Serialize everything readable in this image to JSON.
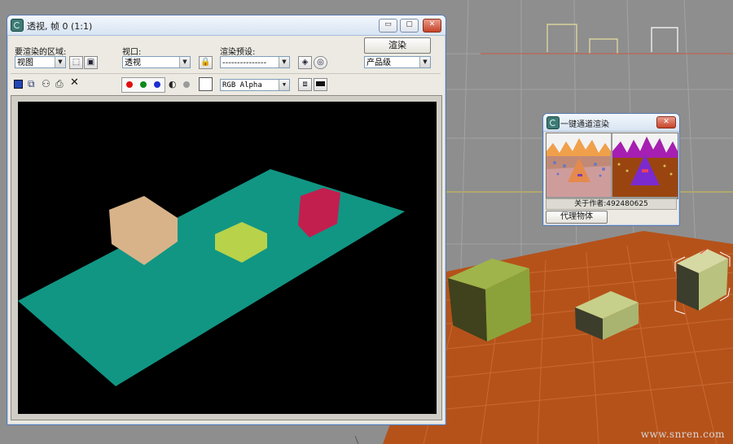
{
  "render_window": {
    "title": "透视, 帧 0 (1:1)",
    "area_label": "要渲染的区域:",
    "area_value": "视图",
    "viewport_label": "视口:",
    "viewport_value": "透视",
    "preset_label": "渲染预设:",
    "preset_value": "---------------",
    "render_button": "渲染",
    "quality_value": "产品级",
    "channel_value": "RGB Alpha",
    "window_min": "▭",
    "window_max": "▢",
    "window_close": "✕",
    "channel_colors": {
      "red": "#e01010",
      "green": "#0a8a1a",
      "blue": "#1a2fd0"
    }
  },
  "plugin_window": {
    "title": "一键通道渲染",
    "about_text": "关于作者:492480625",
    "proxy_button": "代理物体",
    "window_close": "✕"
  },
  "watermark": "www.snren.com",
  "colors": {
    "plane": "#119684",
    "box_left": "#d8b389",
    "box_mid": "#b8d24a",
    "box_right": "#c21f4f",
    "floor": "#b5521a",
    "olive_box": "#8da03c"
  }
}
